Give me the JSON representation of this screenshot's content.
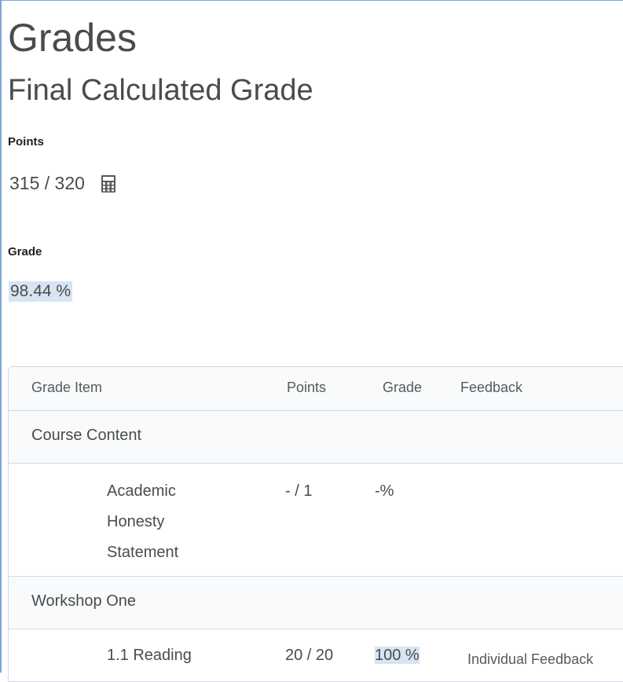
{
  "header": {
    "title": "Grades",
    "subtitle": "Final Calculated Grade"
  },
  "summary": {
    "points_label": "Points",
    "points_value": "315 / 320",
    "calculator_icon": "calculator-icon",
    "grade_label": "Grade",
    "grade_value": "98.44 %"
  },
  "table": {
    "columns": [
      "Grade Item",
      "Points",
      "Grade",
      "Feedback"
    ],
    "categories": [
      {
        "name": "Course Content",
        "items": [
          {
            "name": "Academic Honesty Statement",
            "points": "- / 1",
            "grade": "-%",
            "feedback": ""
          }
        ]
      },
      {
        "name": "Workshop One",
        "items": [
          {
            "name": "1.1 Reading",
            "points": "20 / 20",
            "grade": "100 %",
            "feedback": "Individual Feedback"
          }
        ]
      }
    ]
  },
  "colors": {
    "text": "#494c4e",
    "highlight": "#d7e4f2",
    "border": "#d3d9e3",
    "header_bg": "#f9fafb",
    "frame": "#7ea6d2"
  }
}
